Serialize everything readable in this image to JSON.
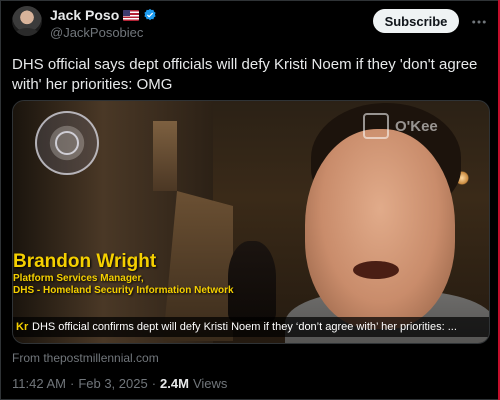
{
  "author": {
    "display_name": "Jack Poso",
    "handle": "@JackPosobiec",
    "flag_icon": "us-flag-icon",
    "verified_icon": "verified-badge-icon",
    "verified_color": "#1d9bf0"
  },
  "header": {
    "subscribe_label": "Subscribe",
    "more_icon": "more-horizontal-icon"
  },
  "tweet": {
    "text": "DHS official says dept officials will defy Kristi Noem if they 'don't agree with' her priorities: OMG"
  },
  "media": {
    "lower_third": {
      "name": "Brandon Wright",
      "title": "Platform Services Manager,",
      "org": "DHS - Homeland Security Information Network"
    },
    "watermark_text": "O'Kee",
    "caption_tag": "Kr",
    "caption_text": "DHS official confirms dept will defy Kristi Noem if they ‘don’t agree with’ her priorities: ...",
    "accent_color": "#f5d000"
  },
  "source": {
    "label": "From thepostmillennial.com"
  },
  "meta": {
    "time": "11:42 AM",
    "separator_1": "·",
    "date": "Feb 3, 2025",
    "separator_2": "·",
    "views_count": "2.4M",
    "views_label": "Views"
  }
}
